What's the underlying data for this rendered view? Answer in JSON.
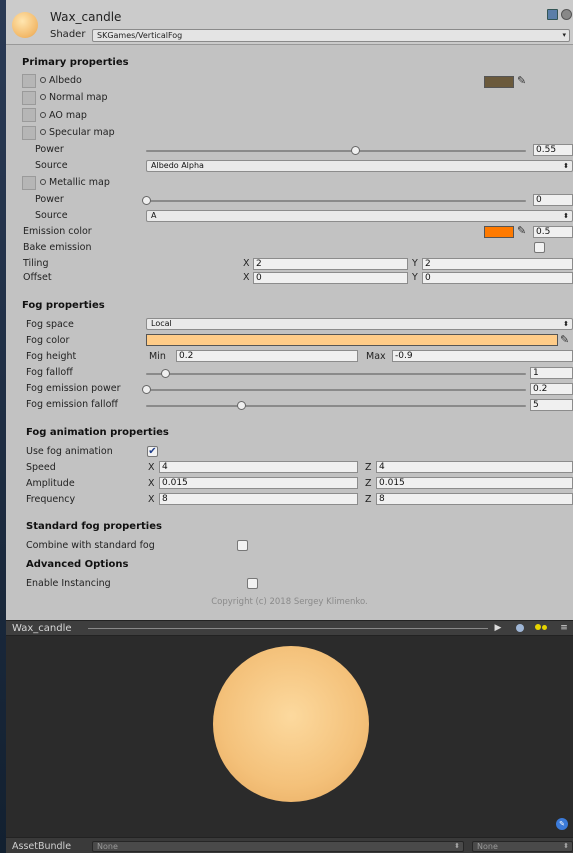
{
  "header": {
    "material_name": "Wax_candle",
    "shader_label": "Shader",
    "shader_value": "SKGames/VerticalFog"
  },
  "primary": {
    "title": "Primary properties",
    "albedo": "Albedo",
    "normal_map": "Normal map",
    "ao_map": "AO map",
    "specular_map": "Specular map",
    "power_label": "Power",
    "spec_power_value": "0.55",
    "spec_power_level": 0.55,
    "source_label": "Source",
    "spec_source": "Albedo Alpha",
    "metallic_map": "Metallic map",
    "metal_power_value": "0",
    "metal_power_level": 0,
    "metal_source": "A",
    "emission_color": "Emission color",
    "emission_value": "0.5",
    "bake_emission": "Bake emission",
    "tiling": "Tiling",
    "offset": "Offset",
    "tiling_x": "2",
    "tiling_y": "2",
    "offset_x": "0",
    "offset_y": "0",
    "albedo_color": "#6b5a3c",
    "emission_rgb": "#ff7a00"
  },
  "fog": {
    "title": "Fog properties",
    "space_label": "Fog space",
    "space_value": "Local",
    "color_label": "Fog color",
    "color": "#ffcc88",
    "height_label": "Fog height",
    "min_label": "Min",
    "min_value": "0.2",
    "max_label": "Max",
    "max_value": "-0.9",
    "falloff_label": "Fog falloff",
    "falloff_value": "1",
    "falloff_level": 0.05,
    "emission_power_label": "Fog emission power",
    "emission_power_value": "0.2",
    "emission_power_level": 0,
    "emission_falloff_label": "Fog emission falloff",
    "emission_falloff_value": "5",
    "emission_falloff_level": 0.25
  },
  "anim": {
    "title": "Fog animation properties",
    "use_label": "Use fog animation",
    "use_checked": "✔",
    "speed_label": "Speed",
    "speed_x": "4",
    "speed_z": "4",
    "amplitude_label": "Amplitude",
    "amplitude_x": "0.015",
    "amplitude_z": "0.015",
    "frequency_label": "Frequency",
    "frequency_x": "8",
    "frequency_z": "8"
  },
  "standard": {
    "title": "Standard fog properties",
    "combine_label": "Combine with standard fog"
  },
  "advanced": {
    "title": "Advanced Options",
    "instancing_label": "Enable Instancing"
  },
  "copyright": "Copyright (c) 2018 Sergey Klimenko.",
  "preview": {
    "title": "Wax_candle"
  },
  "footer": {
    "assetbundle_label": "AssetBundle",
    "bundle_value": "None",
    "variant_value": "None"
  },
  "axis": {
    "x": "X",
    "y": "Y",
    "z": "Z"
  },
  "icons": {
    "eyedropper": "⁄",
    "dd_arrow": "⬍",
    "play": "▶",
    "tag": "✎"
  }
}
